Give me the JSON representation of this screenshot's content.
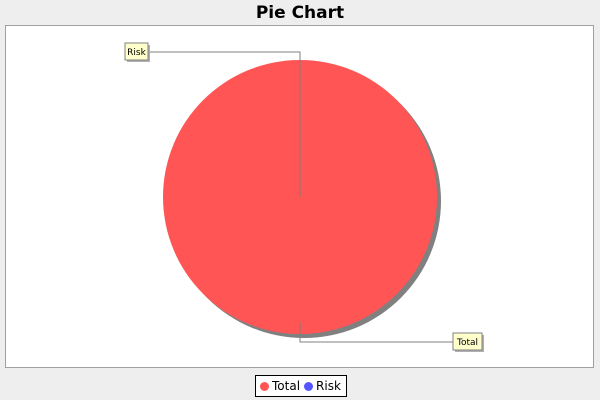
{
  "chart_data": {
    "type": "pie",
    "title": "Pie Chart",
    "slices": [
      {
        "label": "Total",
        "value": 100,
        "color": "#ff5555"
      },
      {
        "label": "Risk",
        "value": 0,
        "color": "#5555ff"
      }
    ],
    "legend": {
      "placement": "bottom",
      "entries": [
        {
          "label": "Total",
          "color": "#ff5555"
        },
        {
          "label": "Risk",
          "color": "#5555ff"
        }
      ]
    },
    "colors": {
      "shadow": "#808080",
      "label_bg": "#ffffcc",
      "leader_line": "#808080"
    }
  }
}
